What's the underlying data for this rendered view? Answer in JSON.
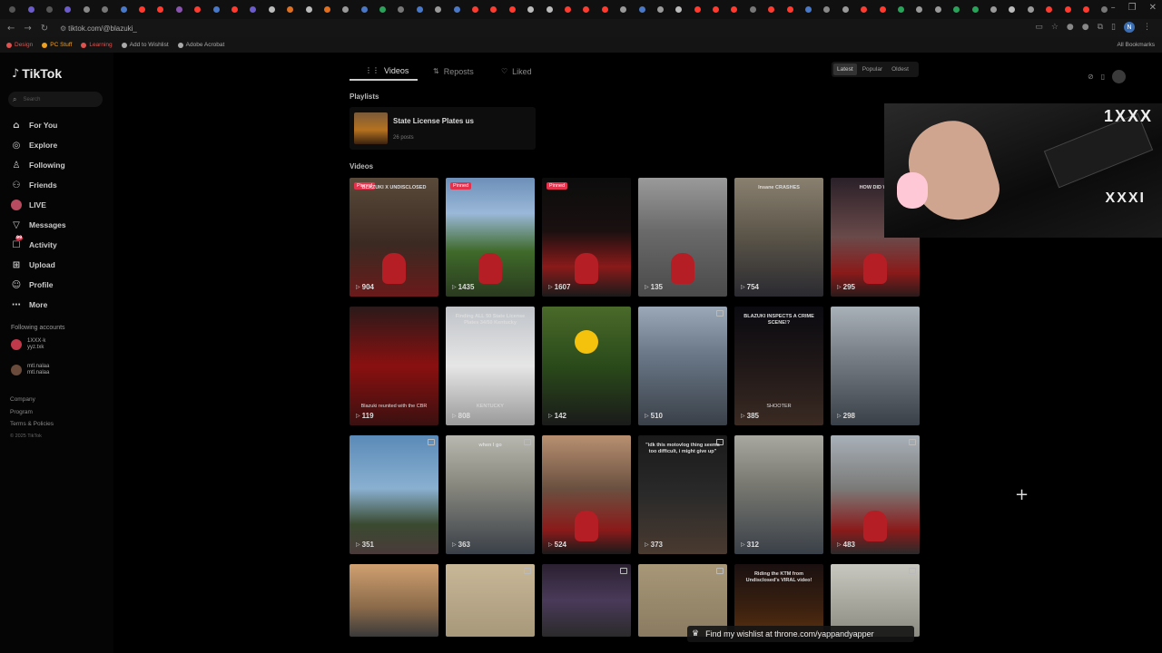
{
  "browser": {
    "tab_colors": [
      "#555",
      "#6b5cc9",
      "#555",
      "#6b5cc9",
      "#888",
      "#777",
      "#4a78c8",
      "#ff3b30",
      "#ff3b30",
      "#8a53b0",
      "#ff3b30",
      "#4a78c8",
      "#ff3b30",
      "#6b5cc9",
      "#bbb",
      "#e07020",
      "#bbb",
      "#e07020",
      "#999",
      "#4a78c8",
      "#2aa35a",
      "#777",
      "#4a78c8",
      "#999",
      "#4a78c8",
      "#ff3b30",
      "#ff3b30",
      "#ff3b30",
      "#bbb",
      "#bbb",
      "#ff3b30",
      "#ff3b30",
      "#ff3b30",
      "#999",
      "#4a78c8",
      "#999",
      "#bbb",
      "#ff3b30",
      "#ff3b30",
      "#ff3b30",
      "#777",
      "#ff3b30",
      "#ff3b30",
      "#4a78c8",
      "#888",
      "#999",
      "#ff3b30",
      "#ff3b30",
      "#2aa35a",
      "#999",
      "#999",
      "#2aa35a",
      "#2aa35a",
      "#999",
      "#bbb",
      "#999",
      "#ff3b30",
      "#ff3b30",
      "#ff3b30",
      "#777"
    ],
    "url": "tiktok.com/@blazuki_",
    "bookmarks": [
      {
        "label": "Design",
        "color": "#e0524f"
      },
      {
        "label": "PC Stuff",
        "color": "#f0a020"
      },
      {
        "label": "Learning",
        "color": "#e0524f"
      },
      {
        "label": "Add to Wishlist",
        "color": "#aaa"
      },
      {
        "label": "Adobe Acrobat",
        "color": "#aaa"
      }
    ],
    "all_bookmarks": "All Bookmarks",
    "profile_letter": "N"
  },
  "sidebar": {
    "logo_text": "TikTok",
    "search_placeholder": "Search",
    "nav": [
      {
        "label": "For You",
        "icon": "home-icon",
        "glyph": "⌂"
      },
      {
        "label": "Explore",
        "icon": "compass-icon",
        "glyph": "◎"
      },
      {
        "label": "Following",
        "icon": "following-icon",
        "glyph": "♙"
      },
      {
        "label": "Friends",
        "icon": "friends-icon",
        "glyph": "⚇"
      },
      {
        "label": "LIVE",
        "icon": "live-avatar-icon",
        "glyph": ""
      },
      {
        "label": "Messages",
        "icon": "messages-icon",
        "glyph": "▽"
      },
      {
        "label": "Activity",
        "icon": "activity-icon",
        "glyph": "☐",
        "badge": "99"
      },
      {
        "label": "Upload",
        "icon": "upload-icon",
        "glyph": "⊞"
      },
      {
        "label": "Profile",
        "icon": "profile-icon",
        "glyph": "☺"
      },
      {
        "label": "More",
        "icon": "more-icon",
        "glyph": "⋯"
      }
    ],
    "following_title": "Following accounts",
    "following": [
      {
        "line1": "1XXX·k",
        "line2": "yyz.txk",
        "color": "#c0394b"
      },
      {
        "line1": "mtl.nalaa",
        "line2": "mtl.nalaa",
        "color": "#6a4a3a"
      }
    ],
    "footer": [
      "Company",
      "Program",
      "Terms & Policies"
    ],
    "copyright": "© 2025 TikTok"
  },
  "main": {
    "tabs": [
      {
        "label": "Videos",
        "glyph": "⋮⋮"
      },
      {
        "label": "Reposts",
        "glyph": "⇅"
      },
      {
        "label": "Liked",
        "glyph": "♡"
      }
    ],
    "sort": [
      "Latest",
      "Popular",
      "Oldest"
    ],
    "playlists_label": "Playlists",
    "playlist": {
      "name": "State License Plates us",
      "count": "26 posts"
    },
    "videos_label": "Videos",
    "videos": [
      {
        "views": "904",
        "pinned": "Pinned",
        "caption": "BLAZUKI X UNDISCLOSED",
        "bg": "linear-gradient(180deg,#5a4a3a 0%,#3a2a22 55%,#6a1a1a 100%)",
        "bike": true
      },
      {
        "views": "1435",
        "pinned": "Pinned",
        "caption": "",
        "bg": "linear-gradient(180deg,#6d8fb8 0%,#9ab8d8 30%,#3f6a2a 62%,#2a3a1f 100%)",
        "bike": true
      },
      {
        "views": "1607",
        "pinned": "Pinned",
        "caption": "",
        "bg": "linear-gradient(180deg,#0c0c0c 0%,#1a1010 45%,#8a1a1a 75%,#1a1a1a 100%)",
        "bike": true
      },
      {
        "views": "135",
        "caption": "",
        "bg": "linear-gradient(180deg,#9a9a9a 0%,#6a6a6a 45%,#4a4a4a 100%)",
        "bike": true
      },
      {
        "views": "754",
        "caption": "Insane CRASHES",
        "bg": "linear-gradient(180deg,#8a8070 0%,#5a5448 50%,#2a2a30 100%)"
      },
      {
        "views": "295",
        "caption": "HOW DID WE",
        "bg": "linear-gradient(180deg,#2a2028 0%,#6a4a4a 50%,#8a1a1a 80%,#2a1a1a 100%)",
        "bike": true
      },
      {
        "views": "119",
        "caption": "",
        "bg": "linear-gradient(180deg,#2a1a1a 0%,#8a1010 50%,#3a1010 100%)",
        "lower": "Blazuki reunited with the CBR"
      },
      {
        "views": "808",
        "caption": "Finding ALL 50 State License Plates 34/50 Kentucky",
        "bg": "linear-gradient(180deg,#bfc3c8 0%,#e6e6e6 50%,#9a9a9a 100%)",
        "lower": "KENTUCKY"
      },
      {
        "views": "142",
        "caption": "",
        "bg": "linear-gradient(180deg,#4a6a2a 0%,#2a4a1a 50%,#1a1a1a 100%)",
        "emoji": true
      },
      {
        "views": "510",
        "multi": true,
        "caption": "",
        "bg": "linear-gradient(180deg,#9aa8b8 0%,#6a7888 40%,#3a4048 100%)"
      },
      {
        "views": "385",
        "caption": "BLAZUKI INSPECTS A CRIME SCENE!?",
        "bg": "linear-gradient(180deg,#0a0a10 0%,#201818 50%,#3a2a22 100%)",
        "lower": "SHOOTER"
      },
      {
        "views": "298",
        "caption": "",
        "bg": "linear-gradient(180deg,#a8b0b8 0%,#7a8088 40%,#3a4048 100%)"
      },
      {
        "views": "351",
        "multi": true,
        "caption": "",
        "bg": "linear-gradient(180deg,#5a8ab8 0%,#8ab0d0 45%,#3a4a30 75%,#4a3a3a 100%)"
      },
      {
        "views": "363",
        "multi": true,
        "caption": "when I go",
        "bg": "linear-gradient(180deg,#b8b8b0 0%,#8a8a80 40%,#3a4048 100%)"
      },
      {
        "views": "524",
        "caption": "",
        "bg": "linear-gradient(180deg,#b89070 0%,#6a5040 45%,#8a1a1a 80%,#1a1a1a 100%)",
        "bike": true
      },
      {
        "views": "373",
        "multi": true,
        "caption": "\"idk this motovlog thing seems too difficult, i might give up\"",
        "bg": "linear-gradient(180deg,#1a1a1a 0%,#2a2a2a 50%,#4a3a30 100%)"
      },
      {
        "views": "312",
        "caption": "",
        "bg": "linear-gradient(180deg,#a8a8a0 0%,#7a7a72 40%,#3a4048 100%)"
      },
      {
        "views": "483",
        "multi": true,
        "caption": "",
        "bg": "linear-gradient(180deg,#a8b0b8 0%,#7a7a78 45%,#8a1a1a 80%,#2a2a2a 100%)",
        "bike": true
      },
      {
        "views": "",
        "caption": "",
        "bg": "linear-gradient(180deg,#d0a070 0%,#8a6a4a 60%,#3a3a3a 100%)"
      },
      {
        "views": "",
        "multi": true,
        "caption": "",
        "bg": "linear-gradient(180deg,#c8b898 0%,#a8987a 100%)"
      },
      {
        "views": "",
        "multi": true,
        "caption": "",
        "bg": "linear-gradient(180deg,#2a2030 0%,#4a3a5a 50%,#2a2a2a 100%)"
      },
      {
        "views": "",
        "multi": true,
        "caption": "",
        "bg": "linear-gradient(180deg,#a89878 0%,#8a7a60 100%)"
      },
      {
        "views": "",
        "caption": "Riding the KTM from Undisclosed's VIRAL video!",
        "bg": "linear-gradient(180deg,#1a1010 0%,#3a2010 60%,#5a3010 100%)"
      },
      {
        "views": "",
        "multi": true,
        "caption": "",
        "bg": "linear-gradient(180deg,#c8c8c0 0%,#8a8a80 100%)"
      }
    ]
  },
  "overlay": {
    "webcam_text_top": "1XXX",
    "webcam_text_bottom": "XXXI",
    "banner_text": "Find my wishlist at throne.com/yappandyapper"
  }
}
